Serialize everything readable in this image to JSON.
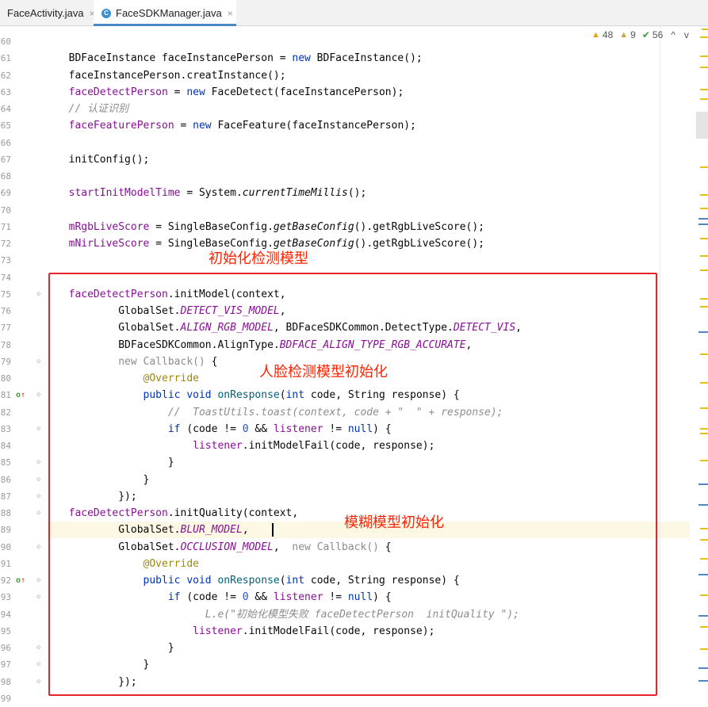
{
  "tabs": [
    {
      "label": "FaceActivity.java",
      "active": false,
      "close": "×"
    },
    {
      "label": "FaceSDKManager.java",
      "active": true,
      "close": "×",
      "icon": "C"
    }
  ],
  "inspections": {
    "warnings": "48",
    "weak_warnings": "9",
    "typos": "56",
    "up": "^",
    "down": "v"
  },
  "colors": {
    "keyword": "#0033b3",
    "field": "#871094",
    "comment": "#8c8c8c",
    "annotation": "#9e880d",
    "number": "#1750eb",
    "method": "#00627a",
    "annotation_red": "#ff2200",
    "current_line": "#fdf8e3"
  },
  "annotations": {
    "init_detect_model": "初始化检测模型",
    "face_detect_init": "人脸检测模型初始化",
    "blur_model_init": "模糊模型初始化"
  },
  "lines": [
    {
      "num": "60",
      "tokens": []
    },
    {
      "num": "61",
      "tokens": [
        [
          "t",
          "        BDFaceInstance faceInstancePerson = "
        ],
        [
          "k",
          "new"
        ],
        [
          "t",
          " BDFaceInstance();"
        ]
      ]
    },
    {
      "num": "62",
      "tokens": [
        [
          "t",
          "        faceInstancePerson.creatInstance();"
        ]
      ]
    },
    {
      "num": "63",
      "tokens": [
        [
          "f",
          "        faceDetectPerson"
        ],
        [
          "t",
          " = "
        ],
        [
          "k",
          "new"
        ],
        [
          "t",
          " FaceDetect(faceInstancePerson);"
        ]
      ]
    },
    {
      "num": "64",
      "tokens": [
        [
          "c",
          "        // 认证识别"
        ]
      ]
    },
    {
      "num": "65",
      "tokens": [
        [
          "f",
          "        faceFeaturePerson"
        ],
        [
          "t",
          " = "
        ],
        [
          "k",
          "new"
        ],
        [
          "t",
          " FaceFeature(faceInstancePerson);"
        ]
      ]
    },
    {
      "num": "66",
      "tokens": []
    },
    {
      "num": "67",
      "tokens": [
        [
          "t",
          "        initConfig();"
        ]
      ]
    },
    {
      "num": "68",
      "tokens": []
    },
    {
      "num": "69",
      "tokens": [
        [
          "f",
          "        startInitModelTime"
        ],
        [
          "t",
          " = System."
        ],
        [
          "m",
          "currentTimeMillis"
        ],
        [
          "t",
          "();"
        ]
      ]
    },
    {
      "num": "70",
      "tokens": []
    },
    {
      "num": "71",
      "tokens": [
        [
          "f",
          "        mRgbLiveScore"
        ],
        [
          "t",
          " = SingleBaseConfig."
        ],
        [
          "m",
          "getBaseConfig"
        ],
        [
          "t",
          "().getRgbLiveScore();"
        ]
      ]
    },
    {
      "num": "72",
      "tokens": [
        [
          "f",
          "        mNirLiveScore"
        ],
        [
          "t",
          " = SingleBaseConfig."
        ],
        [
          "m",
          "getBaseConfig"
        ],
        [
          "t",
          "().getRgbLiveScore();"
        ]
      ]
    },
    {
      "num": "73",
      "tokens": []
    },
    {
      "num": "74",
      "tokens": []
    },
    {
      "num": "75",
      "tokens": [
        [
          "f",
          "        faceDetectPerson"
        ],
        [
          "t",
          ".initModel(context,"
        ]
      ]
    },
    {
      "num": "76",
      "tokens": [
        [
          "t",
          "                GlobalSet."
        ],
        [
          "i",
          "DETECT_VIS_MODEL"
        ],
        [
          "t",
          ","
        ]
      ]
    },
    {
      "num": "77",
      "tokens": [
        [
          "t",
          "                GlobalSet."
        ],
        [
          "i",
          "ALIGN_RGB_MODEL"
        ],
        [
          "t",
          ", BDFaceSDKCommon.DetectType."
        ],
        [
          "i",
          "DETECT_VIS"
        ],
        [
          "t",
          ","
        ]
      ]
    },
    {
      "num": "78",
      "tokens": [
        [
          "t",
          "                BDFaceSDKCommon.AlignType."
        ],
        [
          "i",
          "BDFACE_ALIGN_TYPE_RGB_ACCURATE"
        ],
        [
          "t",
          ","
        ]
      ]
    },
    {
      "num": "79",
      "tokens": [
        [
          "gr",
          "                new"
        ],
        [
          "gr",
          " Callback() "
        ],
        [
          "t",
          "{"
        ]
      ]
    },
    {
      "num": "80",
      "tokens": [
        [
          "a",
          "                    @Override"
        ]
      ]
    },
    {
      "num": "81",
      "tokens": [
        [
          "k",
          "                    public"
        ],
        [
          "t",
          " "
        ],
        [
          "k",
          "void"
        ],
        [
          "t",
          " "
        ],
        [
          "fn",
          "onResponse"
        ],
        [
          "t",
          "("
        ],
        [
          "k",
          "int"
        ],
        [
          "t",
          " code, String response) {"
        ]
      ]
    },
    {
      "num": "82",
      "tokens": [
        [
          "c",
          "                        //  ToastUtils.toast(context, code + \"  \" + response);"
        ]
      ]
    },
    {
      "num": "83",
      "tokens": [
        [
          "k",
          "                        if"
        ],
        [
          "t",
          " (code != "
        ],
        [
          "n",
          "0"
        ],
        [
          "t",
          " && "
        ],
        [
          "f",
          "listener"
        ],
        [
          "t",
          " != "
        ],
        [
          "k",
          "null"
        ],
        [
          "t",
          ") {"
        ]
      ]
    },
    {
      "num": "84",
      "tokens": [
        [
          "f",
          "                            listener"
        ],
        [
          "t",
          ".initModelFail(code, response);"
        ]
      ]
    },
    {
      "num": "85",
      "tokens": [
        [
          "t",
          "                        }"
        ]
      ]
    },
    {
      "num": "86",
      "tokens": [
        [
          "t",
          "                    }"
        ]
      ]
    },
    {
      "num": "87",
      "tokens": [
        [
          "t",
          "                });"
        ]
      ]
    },
    {
      "num": "88",
      "tokens": [
        [
          "f",
          "        faceDetectPerson"
        ],
        [
          "t",
          ".initQuality(context,"
        ]
      ]
    },
    {
      "num": "89",
      "tokens": [
        [
          "t",
          "                GlobalSet."
        ],
        [
          "i",
          "BLUR_MODEL"
        ],
        [
          "t",
          ","
        ]
      ]
    },
    {
      "num": "90",
      "tokens": [
        [
          "t",
          "                GlobalSet."
        ],
        [
          "i",
          "OCCLUSION_MODEL"
        ],
        [
          "t",
          ",  "
        ],
        [
          "gr",
          "new"
        ],
        [
          "gr",
          " Callback() "
        ],
        [
          "t",
          "{"
        ]
      ]
    },
    {
      "num": "91",
      "tokens": [
        [
          "a",
          "                    @Override"
        ]
      ]
    },
    {
      "num": "92",
      "tokens": [
        [
          "k",
          "                    public"
        ],
        [
          "t",
          " "
        ],
        [
          "k",
          "void"
        ],
        [
          "t",
          " "
        ],
        [
          "fn",
          "onResponse"
        ],
        [
          "t",
          "("
        ],
        [
          "k",
          "int"
        ],
        [
          "t",
          " code, String response) {"
        ]
      ]
    },
    {
      "num": "93",
      "tokens": [
        [
          "k",
          "                        if"
        ],
        [
          "t",
          " (code != "
        ],
        [
          "n",
          "0"
        ],
        [
          "t",
          " && "
        ],
        [
          "f",
          "listener"
        ],
        [
          "t",
          " != "
        ],
        [
          "k",
          "null"
        ],
        [
          "t",
          ") {"
        ]
      ]
    },
    {
      "num": "94",
      "tokens": [
        [
          "c",
          "//                            L.e(\"初始化模型失败 faceDetectPerson  initQuality \");"
        ]
      ]
    },
    {
      "num": "95",
      "tokens": [
        [
          "f",
          "                            listener"
        ],
        [
          "t",
          ".initModelFail(code, response);"
        ]
      ]
    },
    {
      "num": "96",
      "tokens": [
        [
          "t",
          "                        }"
        ]
      ]
    },
    {
      "num": "97",
      "tokens": [
        [
          "t",
          "                    }"
        ]
      ]
    },
    {
      "num": "98",
      "tokens": [
        [
          "t",
          "                });"
        ]
      ]
    },
    {
      "num": "99",
      "tokens": []
    }
  ]
}
